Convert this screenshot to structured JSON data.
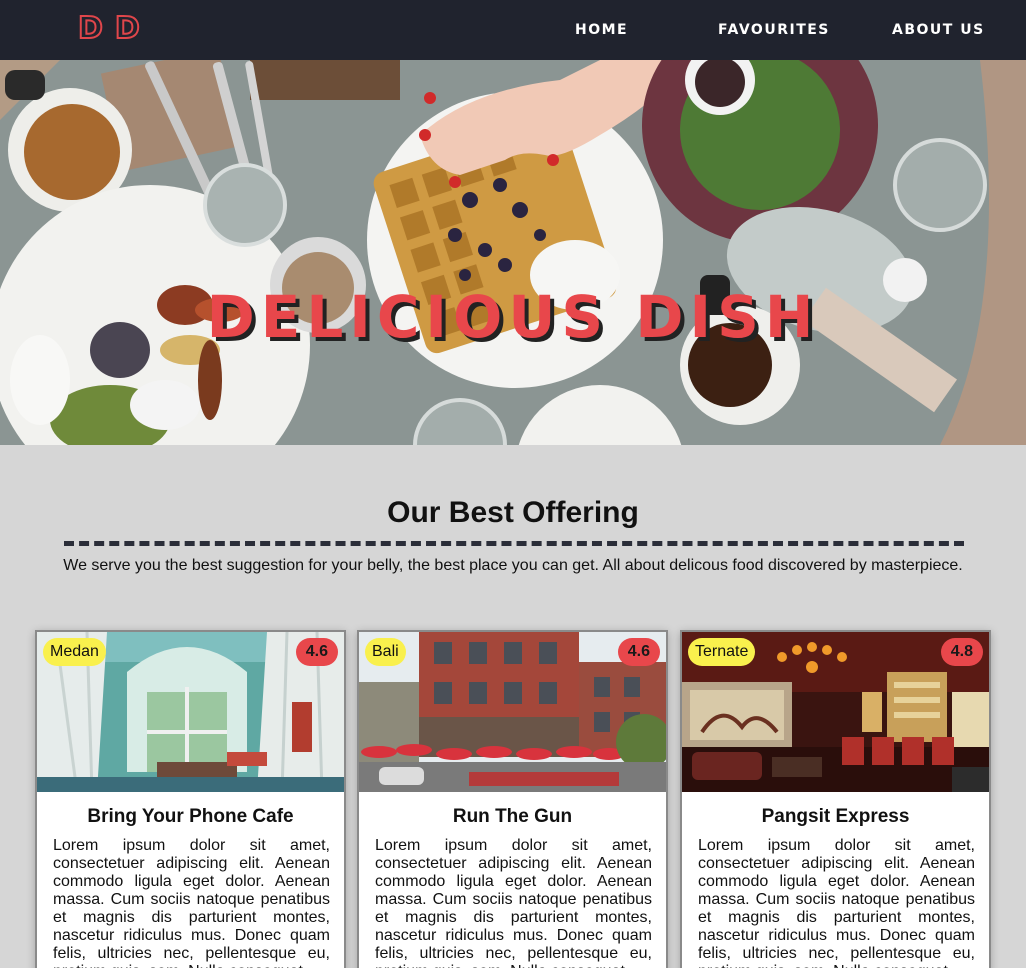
{
  "nav": {
    "logo_letters": [
      "D",
      "D"
    ],
    "links": [
      {
        "label": "HOME"
      },
      {
        "label": "FAVOURITES"
      },
      {
        "label": "ABOUT US"
      }
    ]
  },
  "hero": {
    "title": "DELICIOUS DISH"
  },
  "section": {
    "title": "Our Best Offering",
    "subtitle": "We serve you the best suggestion for your belly, the best place you can get. All about delicous food discovered by masterpiece."
  },
  "cards": [
    {
      "location": "Medan",
      "rating": "4.6",
      "title": "Bring Your Phone Cafe",
      "text": "Lorem ipsum dolor sit amet, consectetuer adipiscing elit. Aenean commodo ligula eget dolor. Aenean massa. Cum sociis natoque penatibus et magnis dis parturient montes, nascetur ridiculus mus. Donec quam felis, ultricies nec, pellentesque eu, pretium quis, sem. Nulla consequat"
    },
    {
      "location": "Bali",
      "rating": "4.6",
      "title": "Run The Gun",
      "text": "Lorem ipsum dolor sit amet, consectetuer adipiscing elit. Aenean commodo ligula eget dolor. Aenean massa. Cum sociis natoque penatibus et magnis dis parturient montes, nascetur ridiculus mus. Donec quam felis, ultricies nec, pellentesque eu, pretium quis, sem. Nulla consequat"
    },
    {
      "location": "Ternate",
      "rating": "4.8",
      "title": "Pangsit Express",
      "text": "Lorem ipsum dolor sit amet, consectetuer adipiscing elit. Aenean commodo ligula eget dolor. Aenean massa. Cum sociis natoque penatibus et magnis dis parturient montes, nascetur ridiculus mus. Donec quam felis, ultricies nec, pellentesque eu, pretium quis, sem. Nulla consequat"
    }
  ],
  "colors": {
    "nav_bg": "#20232e",
    "accent": "#e8474b",
    "badge_yellow": "#f9f04d",
    "page_bg": "#d6d6d6"
  }
}
